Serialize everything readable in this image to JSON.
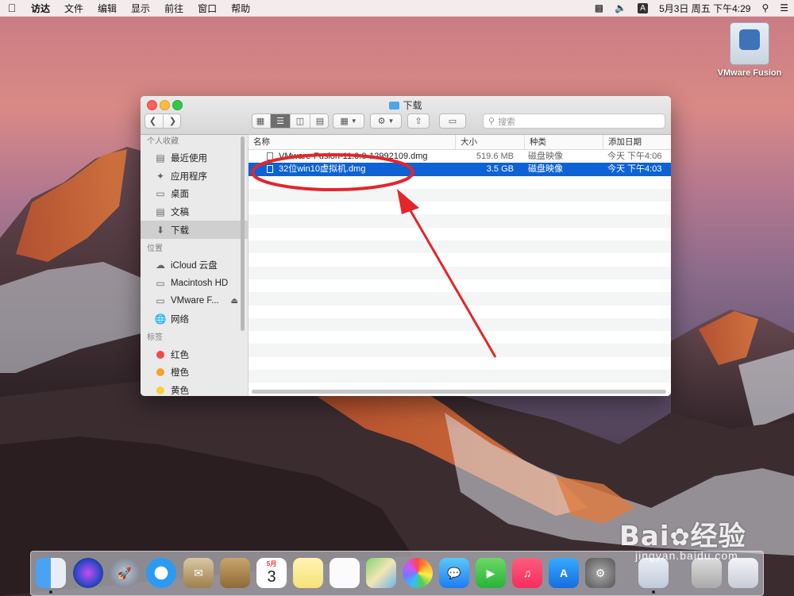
{
  "menubar": {
    "app_name": "访达",
    "items": [
      "文件",
      "编辑",
      "显示",
      "前往",
      "窗口",
      "帮助"
    ],
    "input_badge": "A",
    "datetime": "5月3日 周五 下午4:29"
  },
  "desktop_icon": {
    "label": "VMware Fusion"
  },
  "window": {
    "title": "下载",
    "search_placeholder": "搜索"
  },
  "sidebar": {
    "favorites_header": "个人收藏",
    "favorites": [
      {
        "label": "最近使用",
        "icon": "recents-icon"
      },
      {
        "label": "应用程序",
        "icon": "applications-icon"
      },
      {
        "label": "桌面",
        "icon": "desktop-icon"
      },
      {
        "label": "文稿",
        "icon": "documents-icon"
      },
      {
        "label": "下载",
        "icon": "downloads-icon",
        "selected": true
      }
    ],
    "locations_header": "位置",
    "locations": [
      {
        "label": "iCloud 云盘",
        "icon": "cloud-icon"
      },
      {
        "label": "Macintosh HD",
        "icon": "disk-icon"
      },
      {
        "label": "VMware F...",
        "icon": "disk-icon"
      },
      {
        "label": "网络",
        "icon": "network-icon"
      }
    ],
    "tags_header": "标签",
    "tags": [
      {
        "label": "红色",
        "color": "#f04a4a"
      },
      {
        "label": "橙色",
        "color": "#f6a325"
      },
      {
        "label": "黄色",
        "color": "#f7d038"
      }
    ]
  },
  "list": {
    "columns": {
      "name": "名称",
      "size": "大小",
      "kind": "种类",
      "date": "添加日期"
    },
    "files": [
      {
        "name": "VMware-Fusion-11.0.0-12992109.dmg",
        "size": "519.6 MB",
        "kind": "磁盘映像",
        "date": "今天 下午4:06",
        "selected": false
      },
      {
        "name": "32位win10虚拟机.dmg",
        "size": "3.5 GB",
        "kind": "磁盘映像",
        "date": "今天 下午4:03",
        "selected": true
      }
    ]
  },
  "dock": {
    "calendar_month": "5月",
    "calendar_day": "3"
  },
  "watermark": {
    "brand": "Bai",
    "brand2": "经验",
    "url": "jingyan.baidu.com"
  },
  "colors": {
    "selection": "#0d62d6",
    "annotation": "#e3262b"
  }
}
